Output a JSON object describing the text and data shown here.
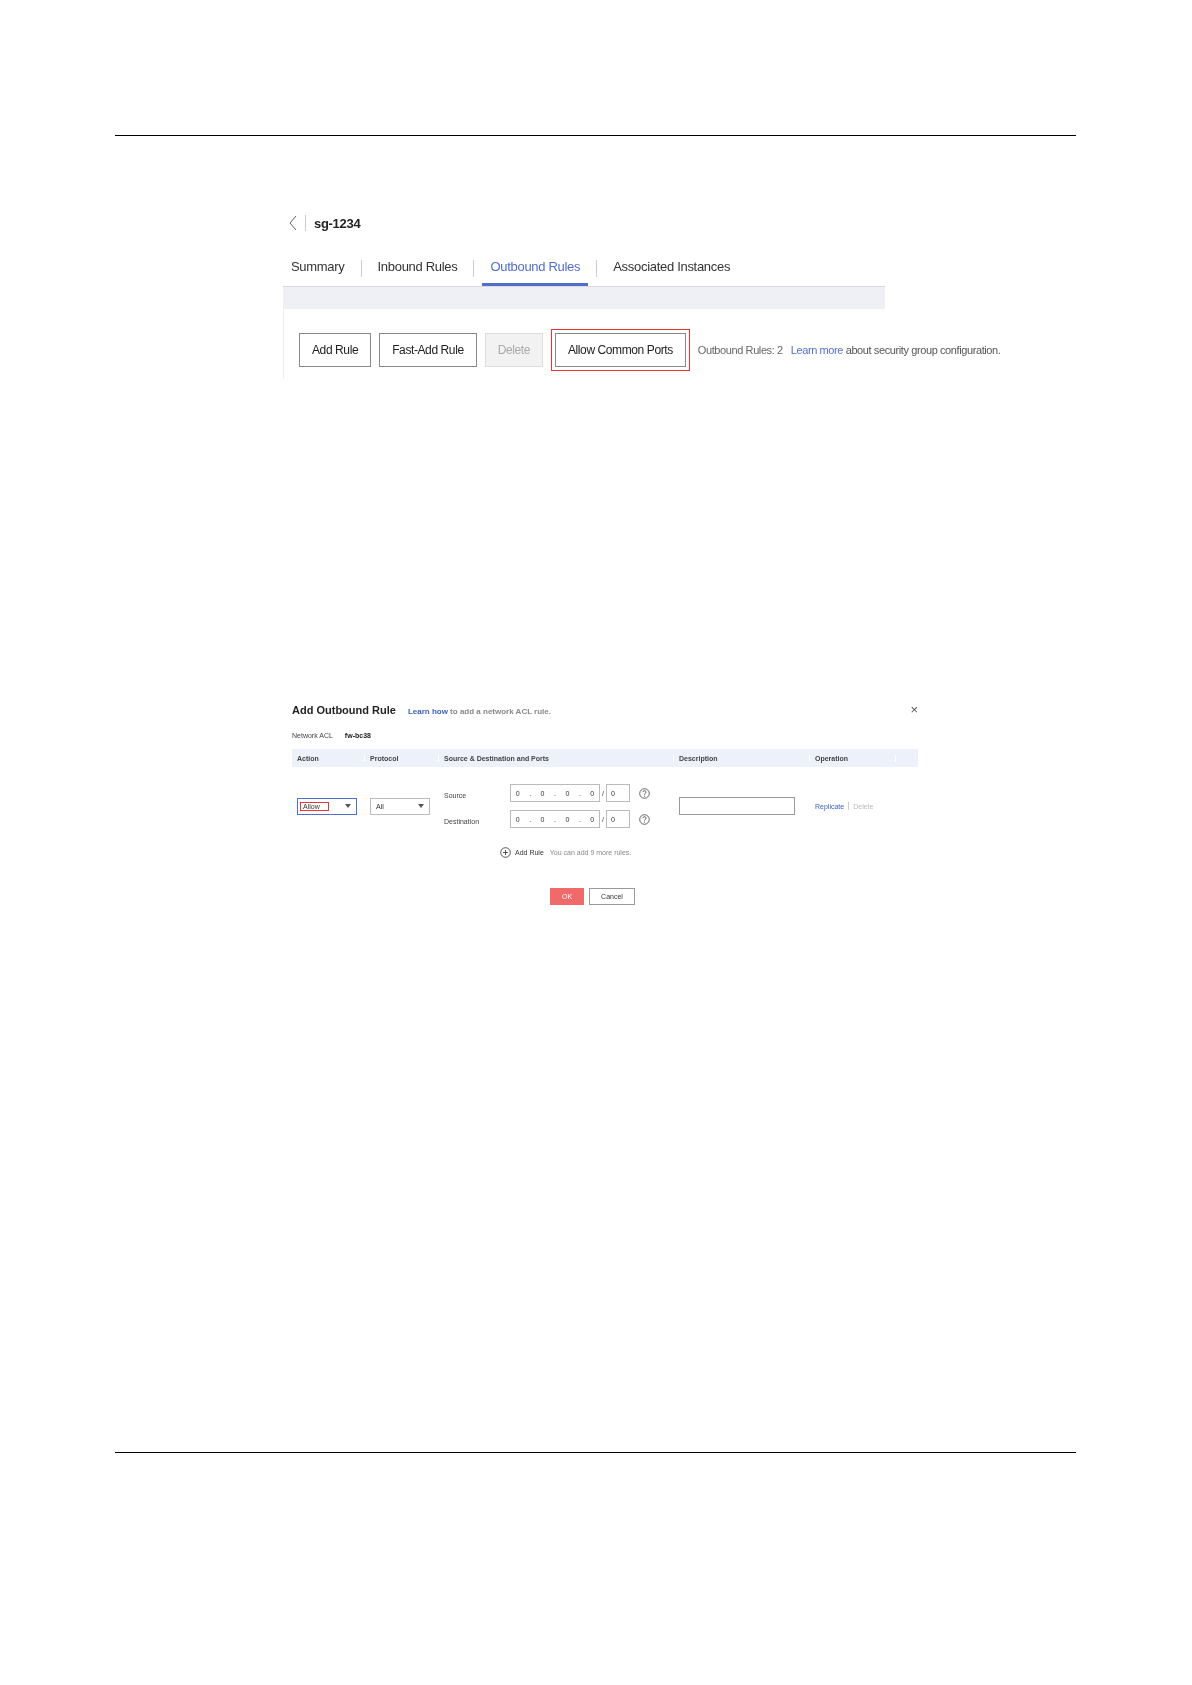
{
  "security_group_screen": {
    "title": "sg-1234",
    "tabs": [
      {
        "label": "Summary",
        "selected": false
      },
      {
        "label": "Inbound Rules",
        "selected": false
      },
      {
        "label": "Outbound Rules",
        "selected": true
      },
      {
        "label": "Associated Instances",
        "selected": false
      }
    ],
    "buttons": [
      {
        "label": "Add Rule",
        "disabled": false,
        "highlighted": false
      },
      {
        "label": "Fast-Add Rule",
        "disabled": false,
        "highlighted": false
      },
      {
        "label": "Delete",
        "disabled": true,
        "highlighted": false
      },
      {
        "label": "Allow Common Ports",
        "disabled": false,
        "highlighted": true
      }
    ],
    "rule_count": "Outbound Rules: 2",
    "info": {
      "link": "Learn more",
      "text": "about security group configuration."
    }
  },
  "add_rule_dialog": {
    "title": "Add Outbound Rule",
    "close": "×",
    "hint": {
      "link": "Learn how",
      "text": "to add a network ACL rule."
    },
    "network_acl": {
      "label": "Network ACL",
      "value": "fw-bc38"
    },
    "columns": [
      "Action",
      "Protocol",
      "Source & Destination and Ports",
      "Description",
      "Operation"
    ],
    "row": {
      "action": {
        "value": "Allow",
        "highlighted": true
      },
      "protocol": {
        "value": "All"
      },
      "addresses": [
        {
          "label": "Source",
          "octets": [
            "0",
            "0",
            "0",
            "0"
          ],
          "dot": ".",
          "slash": "/",
          "mask": "0"
        },
        {
          "label": "Destination",
          "octets": [
            "0",
            "0",
            "0",
            "0"
          ],
          "dot": ".",
          "slash": "/",
          "mask": "0"
        }
      ],
      "operations": [
        {
          "label": "Replicate",
          "disabled": false
        },
        {
          "label": "Delete",
          "disabled": true
        }
      ]
    },
    "add_rule": {
      "label": "Add Rule",
      "note": "You can add 9 more rules."
    },
    "buttons": [
      {
        "label": "OK",
        "kind": "primary"
      },
      {
        "label": "Cancel",
        "kind": "default"
      }
    ]
  }
}
